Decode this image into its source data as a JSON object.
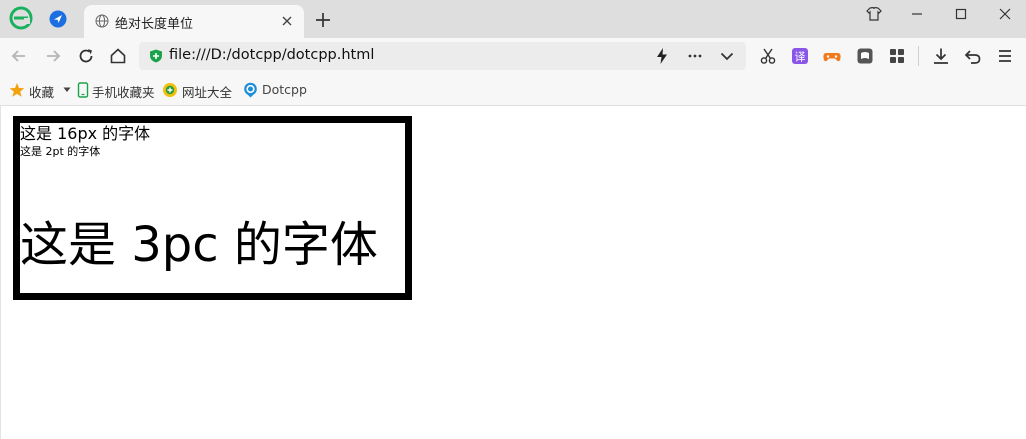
{
  "browser": {
    "tab": {
      "title": "绝对长度单位"
    },
    "address": {
      "url": "file:///D:/dotcpp/dotcpp.html"
    },
    "bookmarks": {
      "favorites_label": "收藏",
      "items": [
        {
          "label": "手机收藏夹",
          "icon": "phone-icon"
        },
        {
          "label": "网址大全",
          "icon": "web-directory-icon"
        },
        {
          "label": "Dotcpp",
          "icon": "dotcpp-icon"
        }
      ]
    },
    "colors": {
      "accent": "#1aa34a",
      "tab_strip": "#dedede",
      "toolbar": "#f7f7f7"
    }
  },
  "page": {
    "lines": [
      {
        "text": "这是 16px 的字体"
      },
      {
        "text": "这是 2pt 的字体"
      },
      {
        "text": "这是 3pc 的字体"
      }
    ]
  }
}
